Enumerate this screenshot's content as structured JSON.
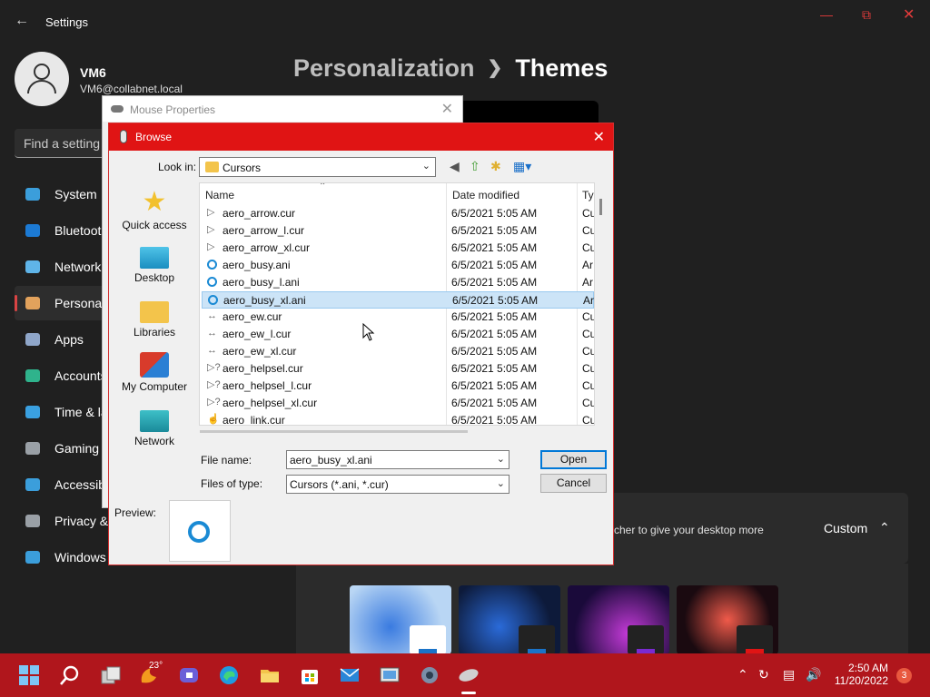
{
  "settings": {
    "title": "Settings",
    "user_name": "VM6",
    "user_email": "VM6@collabnet.local",
    "search_placeholder": "Find a setting",
    "nav": [
      {
        "label": "System",
        "color": "#3b9edb"
      },
      {
        "label": "Bluetooth & devices",
        "color": "#1c7ad4"
      },
      {
        "label": "Network & internet",
        "color": "#5fb4e8"
      },
      {
        "label": "Personalization",
        "color": "#e2a25c"
      },
      {
        "label": "Apps",
        "color": "#8fa6c9"
      },
      {
        "label": "Accounts",
        "color": "#2fb38c"
      },
      {
        "label": "Time & language",
        "color": "#3aa0e0"
      },
      {
        "label": "Gaming",
        "color": "#9aa0a6"
      },
      {
        "label": "Accessibility",
        "color": "#3b9edb"
      },
      {
        "label": "Privacy & security",
        "color": "#9aa0a6"
      },
      {
        "label": "Windows Update",
        "color": "#3b9edb"
      }
    ],
    "breadcrumb_parent": "Personalization",
    "breadcrumb_current": "Themes",
    "custom_text": "cher to give your desktop more",
    "custom_value": "Custom"
  },
  "mouse_properties": {
    "title": "Mouse Properties"
  },
  "browse": {
    "title": "Browse",
    "look_in_label": "Look in:",
    "look_in_value": "Cursors",
    "places": [
      "Quick access",
      "Desktop",
      "Libraries",
      "My Computer",
      "Network"
    ],
    "columns": {
      "name": "Name",
      "date": "Date modified",
      "type": "Ty"
    },
    "files": [
      {
        "name": "aero_arrow.cur",
        "date": "6/5/2021 5:05 AM",
        "type": "Cu",
        "icon": "arrow"
      },
      {
        "name": "aero_arrow_l.cur",
        "date": "6/5/2021 5:05 AM",
        "type": "Cu",
        "icon": "arrow"
      },
      {
        "name": "aero_arrow_xl.cur",
        "date": "6/5/2021 5:05 AM",
        "type": "Cu",
        "icon": "arrow"
      },
      {
        "name": "aero_busy.ani",
        "date": "6/5/2021 5:05 AM",
        "type": "Ar",
        "icon": "busy"
      },
      {
        "name": "aero_busy_l.ani",
        "date": "6/5/2021 5:05 AM",
        "type": "Ar",
        "icon": "busy"
      },
      {
        "name": "aero_busy_xl.ani",
        "date": "6/5/2021 5:05 AM",
        "type": "Ar",
        "icon": "busy"
      },
      {
        "name": "aero_ew.cur",
        "date": "6/5/2021 5:05 AM",
        "type": "Cu",
        "icon": "ew"
      },
      {
        "name": "aero_ew_l.cur",
        "date": "6/5/2021 5:05 AM",
        "type": "Cu",
        "icon": "ew"
      },
      {
        "name": "aero_ew_xl.cur",
        "date": "6/5/2021 5:05 AM",
        "type": "Cu",
        "icon": "ew"
      },
      {
        "name": "aero_helpsel.cur",
        "date": "6/5/2021 5:05 AM",
        "type": "Cu",
        "icon": "help"
      },
      {
        "name": "aero_helpsel_l.cur",
        "date": "6/5/2021 5:05 AM",
        "type": "Cu",
        "icon": "help"
      },
      {
        "name": "aero_helpsel_xl.cur",
        "date": "6/5/2021 5:05 AM",
        "type": "Cu",
        "icon": "help"
      },
      {
        "name": "aero_link.cur",
        "date": "6/5/2021 5:05 AM",
        "type": "Cu",
        "icon": "link"
      }
    ],
    "selected_file": "aero_busy_xl.ani",
    "file_name_label": "File name:",
    "file_name_value": "aero_busy_xl.ani",
    "files_of_type_label": "Files of type:",
    "files_of_type_value": "Cursors (*.ani, *.cur)",
    "open_label": "Open",
    "cancel_label": "Cancel",
    "preview_label": "Preview:"
  },
  "taskbar": {
    "weather_temp": "23°",
    "time": "2:50 AM",
    "date": "11/20/2022",
    "notification_count": "3"
  },
  "colors": {
    "accent": "#e01414",
    "taskbar": "#b0161c",
    "selection": "#cce4f7"
  }
}
